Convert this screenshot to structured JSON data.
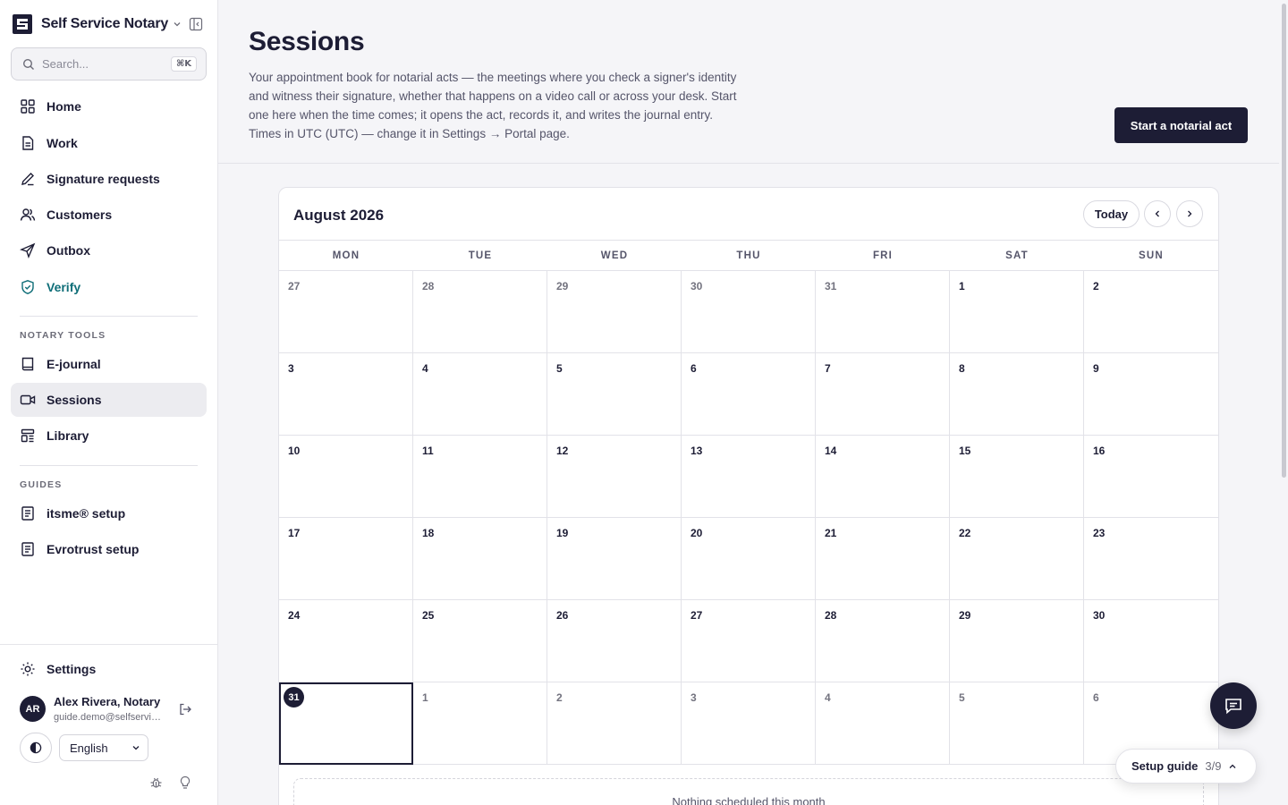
{
  "sidebar": {
    "app_name": "Self Service Notary",
    "search": {
      "placeholder": "Search...",
      "shortcut": "⌘K"
    },
    "nav": [
      {
        "label": "Home",
        "icon": "grid-icon"
      },
      {
        "label": "Work",
        "icon": "document-icon"
      },
      {
        "label": "Signature requests",
        "icon": "pen-icon"
      },
      {
        "label": "Customers",
        "icon": "users-icon"
      },
      {
        "label": "Outbox",
        "icon": "send-icon"
      },
      {
        "label": "Verify",
        "icon": "shield-check-icon"
      }
    ],
    "notary_tools": {
      "heading": "NOTARY TOOLS",
      "items": [
        {
          "label": "E-journal",
          "icon": "book-icon"
        },
        {
          "label": "Sessions",
          "icon": "video-icon"
        },
        {
          "label": "Library",
          "icon": "library-icon"
        }
      ]
    },
    "guides": {
      "heading": "GUIDES",
      "items": [
        {
          "label": "itsme® setup",
          "icon": "guide-icon"
        },
        {
          "label": "Evrotrust setup",
          "icon": "guide-icon"
        }
      ]
    },
    "settings_label": "Settings",
    "user": {
      "initials": "AR",
      "name": "Alex Rivera, Notary",
      "email": "guide.demo@selfservicenotary.com"
    },
    "language": "English"
  },
  "main": {
    "title": "Sessions",
    "description": "Your appointment book for notarial acts — the meetings where you check a signer's identity and witness their signature, whether that happens on a video call or across your desk. Start one here when the time comes; it opens the act, records it, and writes the journal entry. Times in UTC (UTC) — change it in Settings → Portal page.",
    "primary_button": "Start a notarial act"
  },
  "calendar": {
    "month_label": "August 2026",
    "today_button": "Today",
    "weekdays": [
      "MON",
      "TUE",
      "WED",
      "THU",
      "FRI",
      "SAT",
      "SUN"
    ],
    "days": [
      {
        "n": "27",
        "other": true
      },
      {
        "n": "28",
        "other": true
      },
      {
        "n": "29",
        "other": true
      },
      {
        "n": "30",
        "other": true
      },
      {
        "n": "31",
        "other": true
      },
      {
        "n": "1"
      },
      {
        "n": "2"
      },
      {
        "n": "3"
      },
      {
        "n": "4"
      },
      {
        "n": "5"
      },
      {
        "n": "6"
      },
      {
        "n": "7"
      },
      {
        "n": "8"
      },
      {
        "n": "9"
      },
      {
        "n": "10"
      },
      {
        "n": "11"
      },
      {
        "n": "12"
      },
      {
        "n": "13"
      },
      {
        "n": "14"
      },
      {
        "n": "15"
      },
      {
        "n": "16"
      },
      {
        "n": "17"
      },
      {
        "n": "18"
      },
      {
        "n": "19"
      },
      {
        "n": "20"
      },
      {
        "n": "21"
      },
      {
        "n": "22"
      },
      {
        "n": "23"
      },
      {
        "n": "24"
      },
      {
        "n": "25"
      },
      {
        "n": "26"
      },
      {
        "n": "27"
      },
      {
        "n": "28"
      },
      {
        "n": "29"
      },
      {
        "n": "30"
      },
      {
        "n": "31",
        "today": true
      },
      {
        "n": "1",
        "other": true
      },
      {
        "n": "2",
        "other": true
      },
      {
        "n": "3",
        "other": true
      },
      {
        "n": "4",
        "other": true
      },
      {
        "n": "5",
        "other": true
      },
      {
        "n": "6",
        "other": true
      }
    ],
    "empty_message": "Nothing scheduled this month"
  },
  "setup_guide": {
    "label": "Setup guide",
    "progress": "3/9"
  },
  "colors": {
    "primary": "#1d1d35",
    "accent_teal": "#0f6e78",
    "background": "#f5f5f8"
  }
}
